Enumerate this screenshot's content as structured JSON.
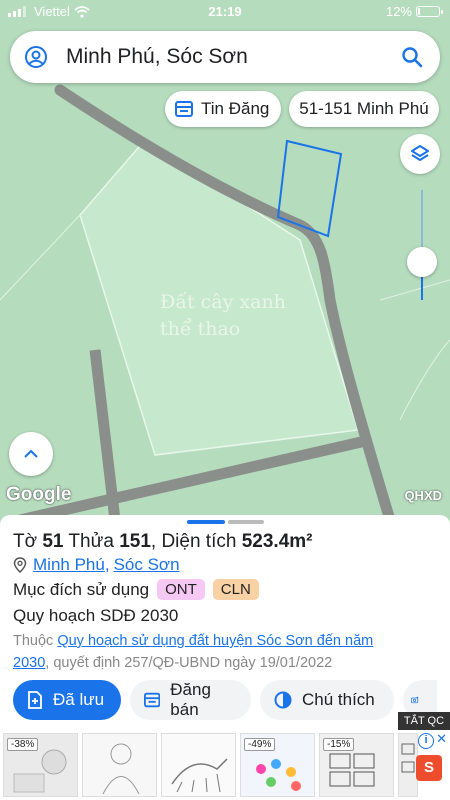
{
  "status_bar": {
    "carrier": "Viettel",
    "time": "21:19",
    "battery_text": "12%",
    "battery_level": 0.12
  },
  "search": {
    "query": "Minh Phú, Sóc Sơn"
  },
  "chips": {
    "tin_dang": "Tin Đăng",
    "address": "51-151 Minh Phú"
  },
  "map": {
    "zone_label_line1": "Đất cây xanh",
    "zone_label_line2": "thể thao",
    "google": "Google",
    "layer_code": "QHXD"
  },
  "sheet": {
    "title_prefix": "Tờ ",
    "sheet_no": "51",
    "title_mid1": " Thửa ",
    "parcel_no": "151",
    "title_mid2": ", Diện tích ",
    "area": "523.4m²",
    "loc_commune": "Minh Phú",
    "loc_sep": ",",
    "loc_district": "Sóc Sơn",
    "purpose_label": "Mục đích sử dụng",
    "badge1": "ONT",
    "badge2": "CLN",
    "plan_label": "Quy hoạch SDĐ 2030",
    "note_prefix": "Thuộc ",
    "note_link_part1": "Quy hoạch sử dụng đất huyện Sóc Sơn đến năm",
    "note_link_part2": "2030",
    "note_suffix": ", quyết định 257/QĐ-UBND ngày 19/01/2022"
  },
  "buttons": {
    "saved": "Đã lưu",
    "sell": "Đăng bán",
    "legend": "Chú thích"
  },
  "ad": {
    "tag": "TẮT QC",
    "info": "i",
    "close": "✕",
    "tiles": [
      {
        "discount": "-38%"
      },
      {
        "discount": ""
      },
      {
        "discount": ""
      },
      {
        "discount": "-49%"
      },
      {
        "discount": "-15%"
      }
    ]
  },
  "colors": {
    "accent": "#1a73e8",
    "map_green": "#b5dcbd",
    "road": "#8a8f8b",
    "parcel_outline": "#1a73e8"
  }
}
